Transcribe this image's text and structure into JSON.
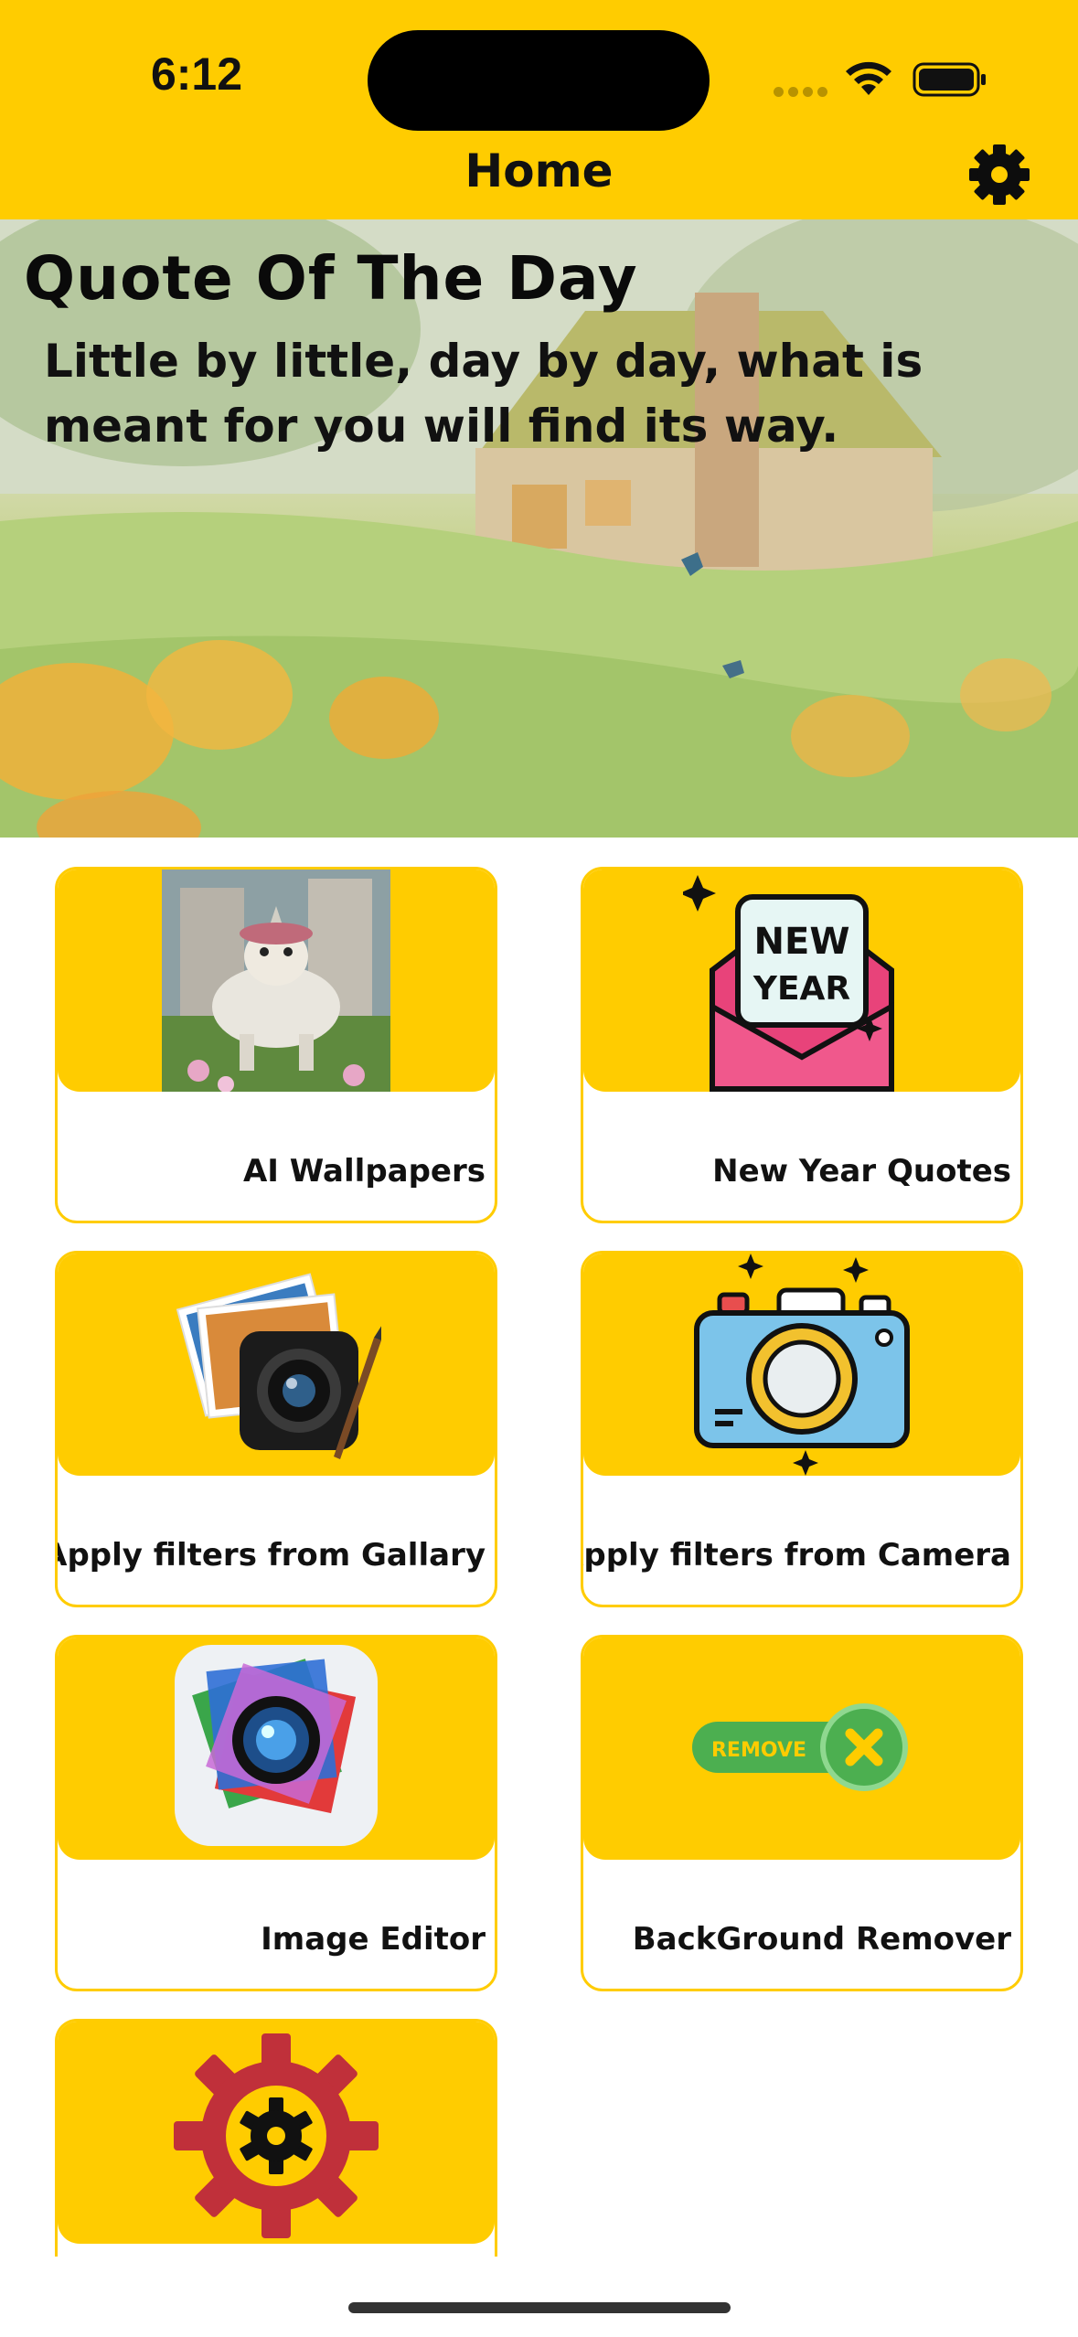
{
  "status_bar": {
    "time": "6:12"
  },
  "nav": {
    "title": "Home",
    "settings_icon": "gear-icon"
  },
  "quote": {
    "title": "Quote Of The Day",
    "text": "Little by little, day by day, what is meant for you will find its way."
  },
  "cards": [
    {
      "label": "AI Wallpapers",
      "icon": "dog-wallpaper-image"
    },
    {
      "label": "New Year Quotes",
      "icon": "new-year-envelope-icon"
    },
    {
      "label": "Apply filters from Gallary",
      "icon": "photos-camera-icon"
    },
    {
      "label": "Apply filters from Camera",
      "icon": "camera-icon"
    },
    {
      "label": "Image Editor",
      "icon": "photo-editor-icon"
    },
    {
      "label": "BackGround Remover",
      "icon": "remove-toggle-icon",
      "badge": "REMOVE"
    },
    {
      "label": "",
      "icon": "gear-settings-icon"
    }
  ],
  "colors": {
    "accent": "#FFCC00",
    "text": "#111111",
    "card_border": "#FFCC00"
  }
}
